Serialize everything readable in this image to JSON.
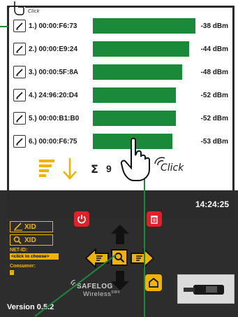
{
  "device_list": {
    "rows": [
      {
        "label": "1.) 00:00:F6:73",
        "signal": "-38 dBm",
        "level": 0.98
      },
      {
        "label": "2.) 00:00:E9:24",
        "signal": "-44 dBm",
        "level": 0.92
      },
      {
        "label": "3.) 00:00:5F:8A",
        "signal": "-48 dBm",
        "level": 0.85
      },
      {
        "label": "4.) 24:96:20:D4",
        "signal": "-52 dBm",
        "level": 0.79
      },
      {
        "label": "5.) 00:00:B1:B0",
        "signal": "-52 dBm",
        "level": 0.79
      },
      {
        "label": "6.) 00:00:F6:75",
        "signal": "-53 dBm",
        "level": 0.76
      }
    ]
  },
  "toolbar": {
    "sigma": "Σ",
    "count": "9"
  },
  "status": {
    "time": "14:24:25"
  },
  "controls": {
    "edit_xid_label": "XID",
    "search_xid_label": "XID",
    "net_id_label": "NET-ID:",
    "net_id_value": "<click to choose>",
    "consumer_label": "Consumer:",
    "consumer_value": "-"
  },
  "branding": {
    "logo_brand": "SAFELOG",
    "logo_sub": "Wireless",
    "logo_suffix": "SWX",
    "version": "Version 0.5.2"
  },
  "annotations": {
    "click_top": "Click",
    "click_main": "Click"
  },
  "colors": {
    "bar_green": "#1a8a3a",
    "accent_yellow": "#f0b400",
    "danger_red": "#e2202a",
    "panel_dark": "#2d2d2d"
  }
}
